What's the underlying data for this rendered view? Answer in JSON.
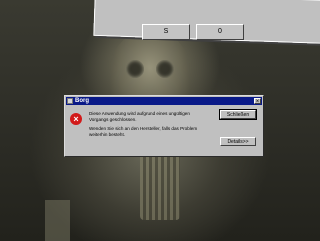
{
  "back_window": {
    "button_1_label": "S",
    "button_2_label": "0"
  },
  "dialog": {
    "title": "Borg",
    "close_glyph": "×",
    "error_glyph": "×",
    "message_1": "Diese Anwendung wird aufgrund eines ungültigen Vorgangs geschlossen.",
    "message_2": "Wenden Sie sich an den Hersteller, falls das Problem weiterhin besteht.",
    "close_button_label": "Schließen",
    "details_button_label": "Details>>"
  },
  "colors": {
    "titlebar": "#0a1a88",
    "error_icon": "#d21a1a",
    "dialog_face": "#c0c0c0"
  }
}
